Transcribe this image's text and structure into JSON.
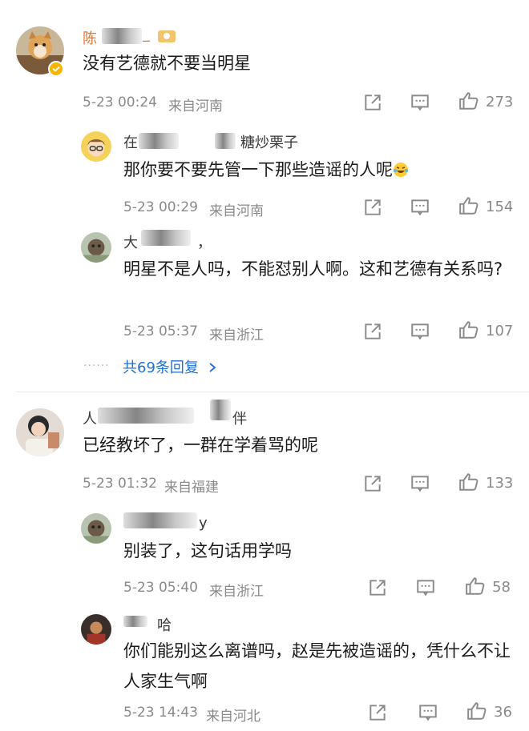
{
  "icons": {
    "share": "share-icon",
    "comment": "comment-icon",
    "like": "like-icon",
    "chevron": "chevron-right-icon",
    "laugh": "laughing-crying-emoji-icon"
  },
  "colors": {
    "name_orange": "#e8742a",
    "link_blue": "#1f6fd6",
    "meta_grey": "#8a8a8a"
  },
  "comments": [
    {
      "username": "陈",
      "username_tail": "_",
      "text": "没有艺德就不要当明星",
      "time": "5-23 00:24",
      "location": "来自河南",
      "likes": "273",
      "replies": [
        {
          "username": "在",
          "username_tail": "糖炒栗子",
          "text": "那你要不要先管一下那些造谣的人呢",
          "time": "5-23 00:29",
          "location": "来自河南",
          "likes": "154"
        },
        {
          "username": "大",
          "username_tail": "，",
          "text": "明星不是人吗，不能怼别人啊。这和艺德有关系吗?",
          "time": "5-23 05:37",
          "location": "来自浙江",
          "likes": "107"
        }
      ],
      "more_replies": "共69条回复"
    },
    {
      "username": "人",
      "username_tail": "伴",
      "text": "已经教坏了，一群在学着骂的呢",
      "time": "5-23 01:32",
      "location": "来自福建",
      "likes": "133",
      "replies": [
        {
          "username": "",
          "username_tail": "y",
          "text": "别装了，这句话用学吗",
          "time": "5-23 05:40",
          "location": "来自浙江",
          "likes": "58"
        },
        {
          "username": "",
          "username_tail": "哈",
          "text": "你们能别这么离谱吗，赵是先被造谣的，凭什么不让人家生气啊",
          "time": "5-23 14:43",
          "location": "来自河北",
          "likes": "36"
        }
      ]
    }
  ]
}
